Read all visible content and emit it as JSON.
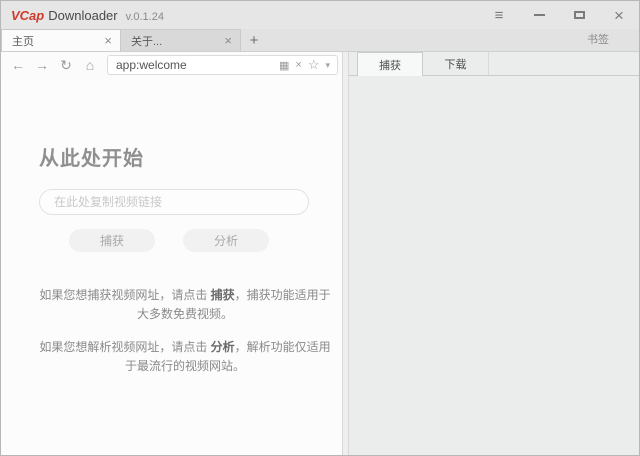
{
  "window": {
    "title_brand": "VCap",
    "title_app": "Downloader",
    "title_version": "v.0.1.24",
    "controls": {
      "menu_glyph": "≡",
      "close_glyph": "×"
    }
  },
  "tabstrip": {
    "tabs": [
      {
        "label": "主页",
        "close_glyph": "×"
      },
      {
        "label": "关于...",
        "close_glyph": "×"
      }
    ],
    "new_tab_label": "+",
    "bookmarks_label": "书签"
  },
  "navbar": {
    "back_glyph": "←",
    "forward_glyph": "→",
    "reload_glyph": "↻",
    "home_glyph": "⌂",
    "address": "app:welcome",
    "scan_glyph": "▦",
    "clear_glyph": "×",
    "star_glyph": "☆",
    "dropdown_glyph": "▾"
  },
  "welcome": {
    "heading": "从此处开始",
    "input_placeholder": "在此处复制视频链接",
    "capture_button": "捕获",
    "analyze_button": "分析",
    "instructions": [
      {
        "pre": "如果您想捕获视频网址，请点击 ",
        "strong": "捕获",
        "post": "，捕获功能适用于大多数免费视频。"
      },
      {
        "pre": "如果您想解析视频网址，请点击 ",
        "strong": "分析",
        "post": "，解析功能仅适用于最流行的视频网站。"
      }
    ]
  },
  "side_panel": {
    "tabs": [
      {
        "label": "捕获"
      },
      {
        "label": "下载"
      }
    ]
  },
  "colors": {
    "brand_red": "#d03a2b",
    "chrome_bg": "#e5e5e5",
    "panel_bg": "#eaedec",
    "active_tab_bg": "#fbfbfb"
  }
}
